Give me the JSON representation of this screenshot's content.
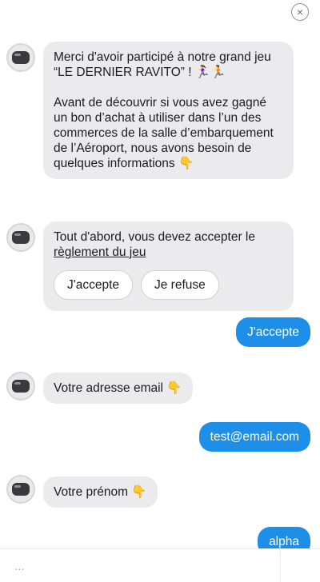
{
  "header": {
    "close_icon": "×"
  },
  "messages": {
    "bot1": {
      "line1": "Merci d'avoir participé à notre grand jeu",
      "line2": "“LE DERNIER RAVITO” ! 🏃‍♀️🏃",
      "para2": "Avant de découvrir si vous avez gagné un bon d’achat à utiliser dans l’un des commerces de la salle d’embarquement de l’Aéroport, nous avons besoin de quelques informations 👇"
    },
    "bot2": {
      "text": "Tout d'abord, vous devez accepter le",
      "link": "règlement du jeu",
      "accept_label": "J'accepte",
      "refuse_label": "Je refuse"
    },
    "user1": "J'accepte",
    "bot3": "Votre adresse email 👇",
    "user2": "test@email.com",
    "bot4": "Votre prénom 👇",
    "user3": "alpha"
  },
  "composer": {
    "placeholder": "..."
  },
  "colors": {
    "user_bubble": "#1e8fe8",
    "bot_bubble": "#ebebee"
  }
}
